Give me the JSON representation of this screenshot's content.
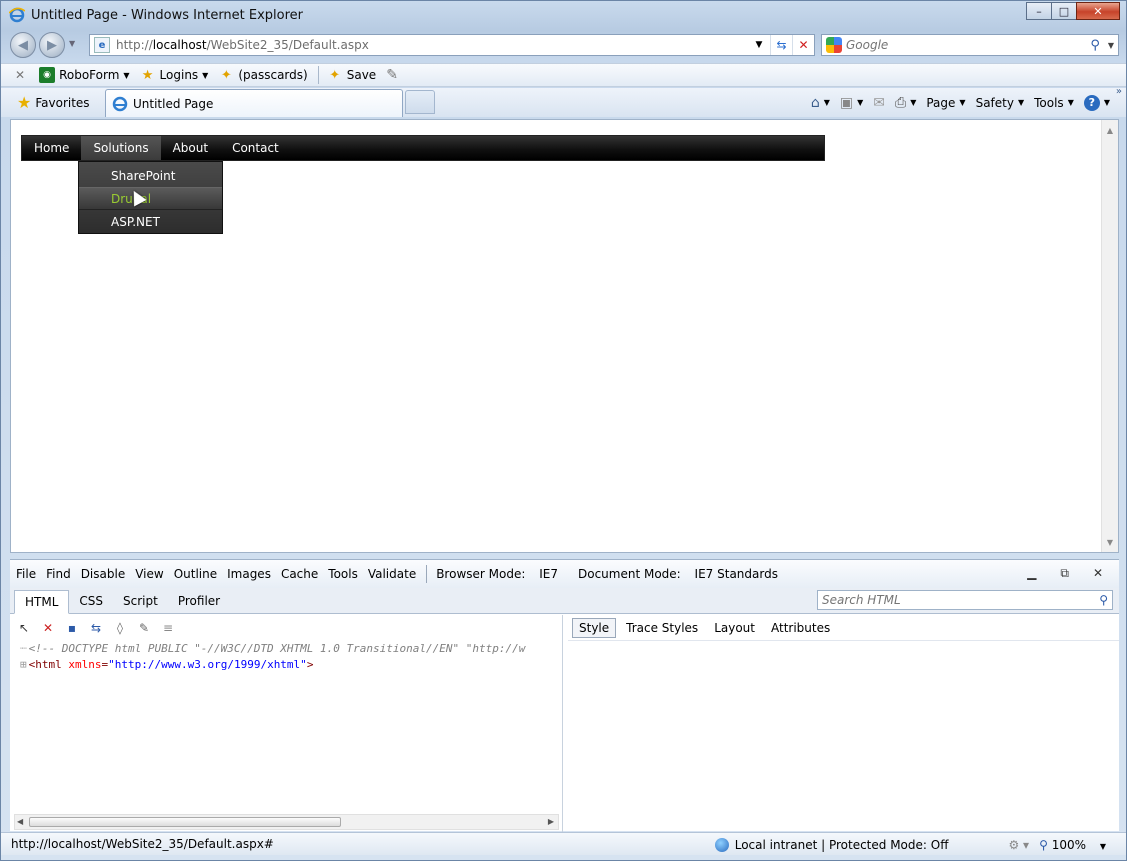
{
  "window": {
    "title": "Untitled Page - Windows Internet Explorer",
    "controls": {
      "minimize": "–",
      "maximize": "□",
      "close": "✕"
    }
  },
  "address_bar": {
    "url_prefix": "http://",
    "url_host": "localhost",
    "url_path": "/WebSite2_35/Default.aspx"
  },
  "search": {
    "placeholder": "Google"
  },
  "roboform": {
    "items": [
      {
        "label": "RoboForm",
        "icon": "roboform-icon"
      },
      {
        "label": "Logins",
        "icon": "logins-icon"
      },
      {
        "label": "(passcards)",
        "icon": "passcards-icon"
      },
      {
        "label": "Save",
        "icon": "save-icon"
      }
    ]
  },
  "favorites": {
    "label": "Favorites"
  },
  "tab": {
    "title": "Untitled Page"
  },
  "command_bar": {
    "page": "Page",
    "safety": "Safety",
    "tools": "Tools"
  },
  "site_menu": {
    "items": [
      "Home",
      "Solutions",
      "About",
      "Contact"
    ],
    "hovered": "Solutions",
    "submenu": [
      "SharePoint",
      "Drupal",
      "ASP.NET"
    ],
    "submenu_hovered": "Drupal"
  },
  "devtools": {
    "menu": [
      "File",
      "Find",
      "Disable",
      "View",
      "Outline",
      "Images",
      "Cache",
      "Tools",
      "Validate"
    ],
    "browser_mode_label": "Browser Mode:",
    "browser_mode_value": "IE7",
    "document_mode_label": "Document Mode:",
    "document_mode_value": "IE7 Standards",
    "tabs": [
      "HTML",
      "CSS",
      "Script",
      "Profiler"
    ],
    "active_tab": "HTML",
    "search_placeholder": "Search HTML",
    "code": {
      "doctype": "<!-- DOCTYPE html PUBLIC \"-//W3C//DTD XHTML 1.0 Transitional//EN\" \"http://w",
      "html_tag_open": "<html ",
      "html_attr": "xmlns",
      "html_eq": "=",
      "html_val": "\"http://www.w3.org/1999/xhtml\"",
      "html_tag_close": ">"
    },
    "right_tabs": [
      "Style",
      "Trace Styles",
      "Layout",
      "Attributes"
    ],
    "active_right_tab": "Style"
  },
  "status": {
    "url": "http://localhost/WebSite2_35/Default.aspx#",
    "zone": "Local intranet | Protected Mode: Off",
    "zoom": "100%"
  }
}
